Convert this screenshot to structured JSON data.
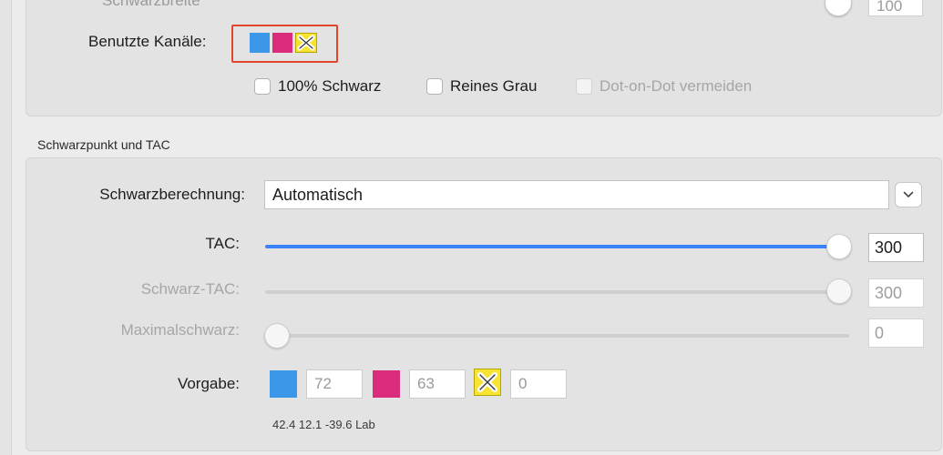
{
  "top_group": {
    "cut_label": "Schwarzbreite",
    "cut_value": "100",
    "channels_label": "Benutzte Kanäle:",
    "checkboxes": [
      {
        "label": "100% Schwarz",
        "checked": false,
        "enabled": true
      },
      {
        "label": "Reines Grau",
        "checked": false,
        "enabled": true
      },
      {
        "label": "Dot-on-Dot vermeiden",
        "checked": false,
        "enabled": false
      }
    ]
  },
  "section_title": "Schwarzpunkt und TAC",
  "black_calc": {
    "label": "Schwarzberechnung:",
    "value": "Automatisch"
  },
  "tac": {
    "label": "TAC:",
    "value": "300",
    "level": 1.0
  },
  "black_tac": {
    "label": "Schwarz-TAC:",
    "value": "300",
    "level": 1.0
  },
  "max_black": {
    "label": "Maximalschwarz:",
    "value": "0",
    "level": 0.0
  },
  "preset": {
    "label": "Vorgabe:",
    "cyan": "72",
    "magenta": "63",
    "yellow": "0",
    "lab": "42.4 12.1 -39.6 Lab"
  },
  "colors": {
    "accent": "#3b82f6",
    "cyan": "#3d97e8",
    "magenta": "#da2b7c",
    "yellow": "#f7e430",
    "highlight": "#e2452b"
  },
  "icons": {
    "dropdown": "chevron-down-icon",
    "yellow_channel": "yellow-x-icon"
  }
}
